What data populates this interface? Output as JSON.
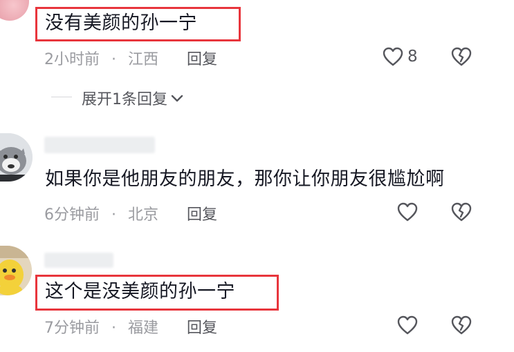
{
  "comments": [
    {
      "text": "没有美颜的孙一宁",
      "time": "2小时前",
      "sep": "·",
      "location": "江西",
      "reply_label": "回复",
      "like_count": "8",
      "expand_label": "展开1条回复"
    },
    {
      "text": "如果你是他朋友的朋友，那你让你朋友很尴尬啊",
      "time": "6分钟前",
      "sep": "·",
      "location": "北京",
      "reply_label": "回复"
    },
    {
      "text": "这个是没美颜的孙一宁",
      "time": "7分钟前",
      "sep": "·",
      "location": "福建",
      "reply_label": "回复"
    }
  ],
  "colors": {
    "highlight_box": "#e8353c",
    "meta_text": "#9a9ba0",
    "body_text": "#161823"
  },
  "icons": [
    "heart-icon",
    "dislike-heart-icon",
    "chevron-down-icon"
  ]
}
